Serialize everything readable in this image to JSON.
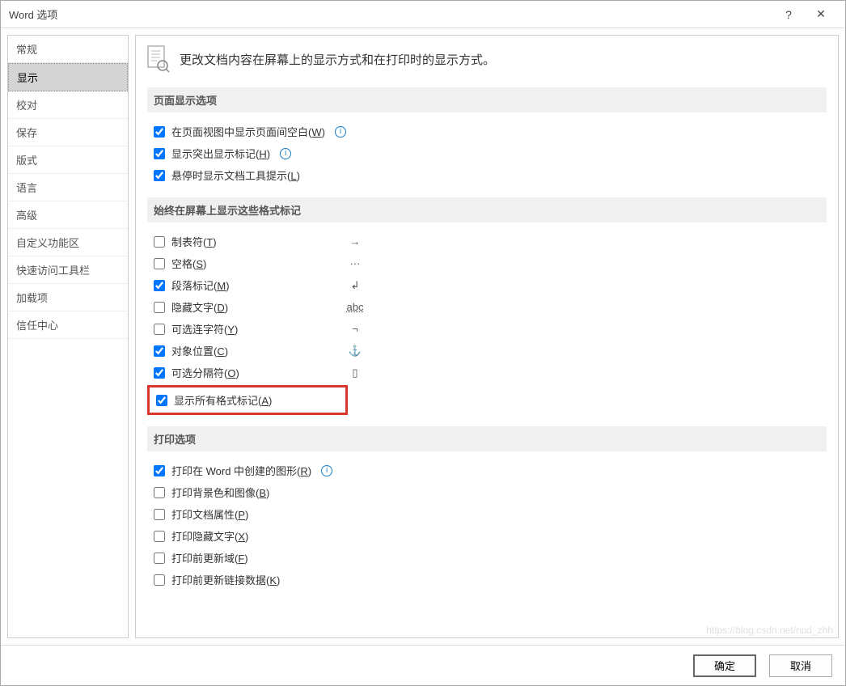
{
  "titlebar": {
    "title": "Word 选项",
    "help": "?",
    "close": "✕"
  },
  "sidebar": {
    "items": [
      {
        "label": "常规"
      },
      {
        "label": "显示",
        "selected": true
      },
      {
        "label": "校对"
      },
      {
        "label": "保存"
      },
      {
        "label": "版式"
      },
      {
        "label": "语言"
      },
      {
        "label": "高级"
      },
      {
        "label": "自定义功能区"
      },
      {
        "label": "快速访问工具栏"
      },
      {
        "label": "加载项"
      },
      {
        "label": "信任中心"
      }
    ]
  },
  "header": {
    "title": "更改文档内容在屏幕上的显示方式和在打印时的显示方式。"
  },
  "sections": {
    "page_display": {
      "title": "页面显示选项",
      "opts": [
        {
          "label": "在页面视图中显示页面间空白(",
          "key": "W",
          "tail": ")",
          "checked": true,
          "info": true
        },
        {
          "label": "显示突出显示标记(",
          "key": "H",
          "tail": ")",
          "checked": true,
          "info": true
        },
        {
          "label": "悬停时显示文档工具提示(",
          "key": "L",
          "tail": ")",
          "checked": true
        }
      ]
    },
    "format_marks": {
      "title": "始终在屏幕上显示这些格式标记",
      "opts": [
        {
          "label": "制表符(",
          "key": "T",
          "tail": ")",
          "checked": false,
          "sym": "→"
        },
        {
          "label": "空格(",
          "key": "S",
          "tail": ")",
          "checked": false,
          "sym": "···"
        },
        {
          "label": "段落标记(",
          "key": "M",
          "tail": ")",
          "checked": true,
          "sym": "↲"
        },
        {
          "label": "隐藏文字(",
          "key": "D",
          "tail": ")",
          "checked": false,
          "sym": "abc"
        },
        {
          "label": "可选连字符(",
          "key": "Y",
          "tail": ")",
          "checked": false,
          "sym": "¬"
        },
        {
          "label": "对象位置(",
          "key": "C",
          "tail": ")",
          "checked": true,
          "sym": "⚓"
        },
        {
          "label": "可选分隔符(",
          "key": "O",
          "tail": ")",
          "checked": true,
          "sym": "▯"
        }
      ],
      "highlight": {
        "label": "显示所有格式标记(",
        "key": "A",
        "tail": ")",
        "checked": true
      }
    },
    "print": {
      "title": "打印选项",
      "opts": [
        {
          "label": "打印在 Word 中创建的图形(",
          "key": "R",
          "tail": ")",
          "checked": true,
          "info": true
        },
        {
          "label": "打印背景色和图像(",
          "key": "B",
          "tail": ")",
          "checked": false
        },
        {
          "label": "打印文档属性(",
          "key": "P",
          "tail": ")",
          "checked": false
        },
        {
          "label": "打印隐藏文字(",
          "key": "X",
          "tail": ")",
          "checked": false
        },
        {
          "label": "打印前更新域(",
          "key": "F",
          "tail": ")",
          "checked": false
        },
        {
          "label": "打印前更新链接数据(",
          "key": "K",
          "tail": ")",
          "checked": false
        }
      ]
    }
  },
  "footer": {
    "ok": "确定",
    "cancel": "取消"
  },
  "watermark": "https://blog.csdn.net/npd_zhh"
}
